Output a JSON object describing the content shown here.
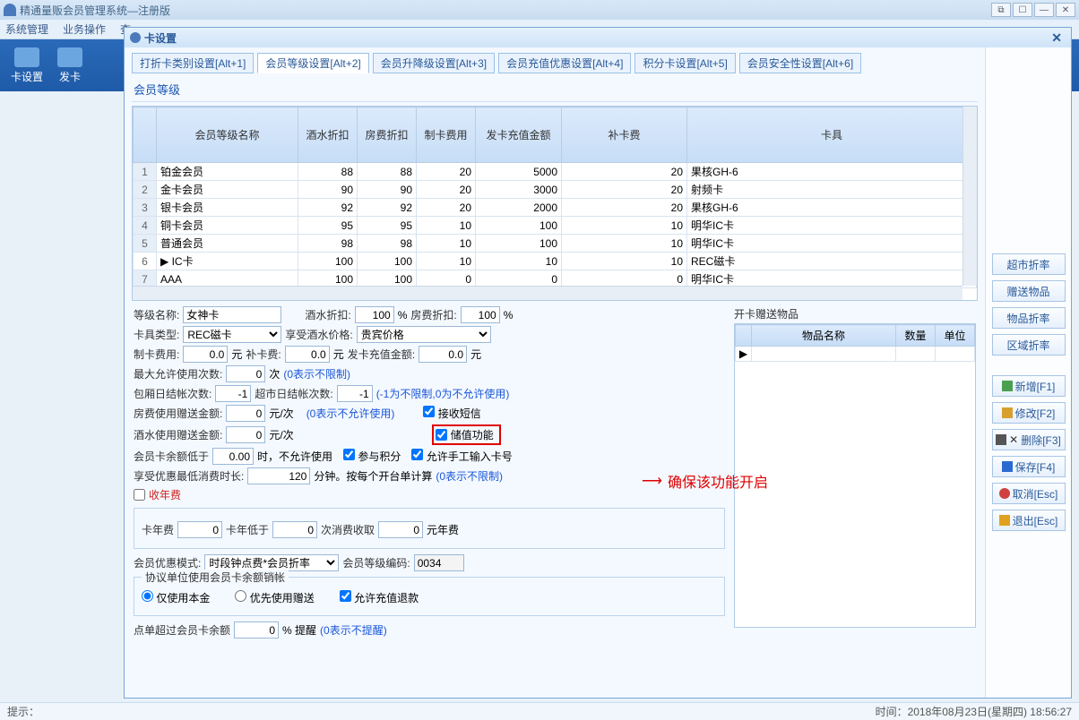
{
  "appTitle": "精通量贩会员管理系统—注册版",
  "menus": [
    "系统管理",
    "业务操作",
    "查"
  ],
  "toolbarItems": [
    {
      "label": "卡设置"
    },
    {
      "label": "发卡"
    }
  ],
  "childWindow": {
    "title": "卡设置"
  },
  "tabs": [
    {
      "label": "打折卡类别设置[Alt+1]"
    },
    {
      "label": "会员等级设置[Alt+2]",
      "active": true
    },
    {
      "label": "会员升降级设置[Alt+3]"
    },
    {
      "label": "会员充值优惠设置[Alt+4]"
    },
    {
      "label": "积分卡设置[Alt+5]"
    },
    {
      "label": "会员安全性设置[Alt+6]"
    }
  ],
  "sectionTitle": "会员等级",
  "gridHeaders": [
    "会员等级名称",
    "酒水折扣",
    "房费折扣",
    "制卡费用",
    "发卡充值金额",
    "补卡费",
    "卡具"
  ],
  "gridRows": [
    {
      "n": 1,
      "name": "铂金会员",
      "d1": 88,
      "d2": 88,
      "f1": 20,
      "cz": 5000,
      "bk": 20,
      "kj": "果核GH-6"
    },
    {
      "n": 2,
      "name": "金卡会员",
      "d1": 90,
      "d2": 90,
      "f1": 20,
      "cz": 3000,
      "bk": 20,
      "kj": "射频卡"
    },
    {
      "n": 3,
      "name": "银卡会员",
      "d1": 92,
      "d2": 92,
      "f1": 20,
      "cz": 2000,
      "bk": 20,
      "kj": "果核GH-6"
    },
    {
      "n": 4,
      "name": "铜卡会员",
      "d1": 95,
      "d2": 95,
      "f1": 10,
      "cz": 100,
      "bk": 10,
      "kj": "明华IC卡"
    },
    {
      "n": 5,
      "name": "普通会员",
      "d1": 98,
      "d2": 98,
      "f1": 10,
      "cz": 100,
      "bk": 10,
      "kj": "明华IC卡"
    },
    {
      "n": 6,
      "name": "IC卡",
      "d1": 100,
      "d2": 100,
      "f1": 10,
      "cz": 10,
      "bk": 10,
      "kj": "REC磁卡",
      "sel": true
    },
    {
      "n": 7,
      "name": "AAA",
      "d1": 100,
      "d2": 100,
      "f1": 0,
      "cz": 0,
      "bk": 0,
      "kj": "明华IC卡"
    }
  ],
  "form": {
    "lblLevelName": "等级名称:",
    "levelName": "女神卡",
    "lblBevDisc": "酒水折扣:",
    "bevDisc": "100",
    "pct": "%",
    "lblRoomDisc": "房费折扣:",
    "roomDisc": "100",
    "lblCardType": "卡具类型:",
    "cardType": "REC磁卡",
    "lblBevPrice": "享受酒水价格:",
    "bevPrice": "贵宾价格",
    "lblCardFee": "制卡费用:",
    "cardFee": "0.0",
    "yuan": "元",
    "lblReissue": "补卡费:",
    "reissue": "0.0",
    "lblRecharge": "发卡充值金额:",
    "recharge": "0.0",
    "lblMaxUse": "最大允许使用次数:",
    "maxUse": "0",
    "times": "次",
    "hintZeroUnlimit": "(0表示不限制)",
    "lblPkgDaily": "包厢日结帐次数:",
    "pkgDaily": "-1",
    "lblMktDaily": "超市日结帐次数:",
    "mktDaily": "-1",
    "hintNeg1": "(-1为不限制,0为不允许使用)",
    "lblRoomGift": "房费使用赠送金额:",
    "roomGiftAmt": "0",
    "perTime": "元/次",
    "hintZeroNoUse": "(0表示不允许使用)",
    "lblBevGift": "酒水使用赠送金额:",
    "bevGiftAmt": "0",
    "lblSms": "接收短信",
    "smsOn": true,
    "lblStore": "储值功能",
    "storeOn": true,
    "lblBalanceLow": "会员卡余额低于",
    "balanceLow": "0.00",
    "lblWhenNoUse": "时，不允许使用",
    "lblJoinPoints": "参与积分",
    "joinPointsOn": true,
    "lblAllowManual": "允许手工输入卡号",
    "allowManualOn": true,
    "lblMinTime": "享受优惠最低消费时长:",
    "minTime": "120",
    "lblMin": "分钟。按每个开台单计算",
    "hintZeroUnlimit2": "(0表示不限制)",
    "lblAnnual": "收年费",
    "annualOn": false,
    "lblCardAnnual": "卡年费",
    "cardAnnual": "0",
    "lblCardYearLow": "卡年低于",
    "cardYearLow": "0",
    "lblPerConsume": "次消费收取",
    "perConsume": "0",
    "lblYuanAnnual": "元年费",
    "lblDiscMode": "会员优惠模式:",
    "discMode": "时段钟点费*会员折率",
    "lblLevelCode": "会员等级编码:",
    "levelCode": "0034",
    "fsTitle": "协议单位使用会员卡余额销帐",
    "optPrincipal": "仅使用本金",
    "optGiftFirst": "优先使用赠送",
    "lblAllowRefund": "允许充值退款",
    "allowRefundOn": true,
    "lblOverBalance": "点单超过会员卡余额",
    "overBalance": "0",
    "lblPctRemind": "% 提醒",
    "hintZeroNoRemind": "(0表示不提醒)"
  },
  "giftTable": {
    "title": "开卡赠送物品",
    "headers": [
      "物品名称",
      "数量",
      "单位"
    ]
  },
  "annotation": "确保该功能开启",
  "sideButtons": {
    "a": "超市折率",
    "b": "赠送物品",
    "c": "物品折率",
    "d": "区域折率",
    "add": "新增[F1]",
    "edit": "修改[F2]",
    "del": "删除[F3]",
    "save": "保存[F4]",
    "cancel": "取消[Esc]",
    "exit": "退出[Esc]"
  },
  "statusPrompt": "提示：",
  "statusTime": "时间：2018年08月23日(星期四) 18:56:27"
}
